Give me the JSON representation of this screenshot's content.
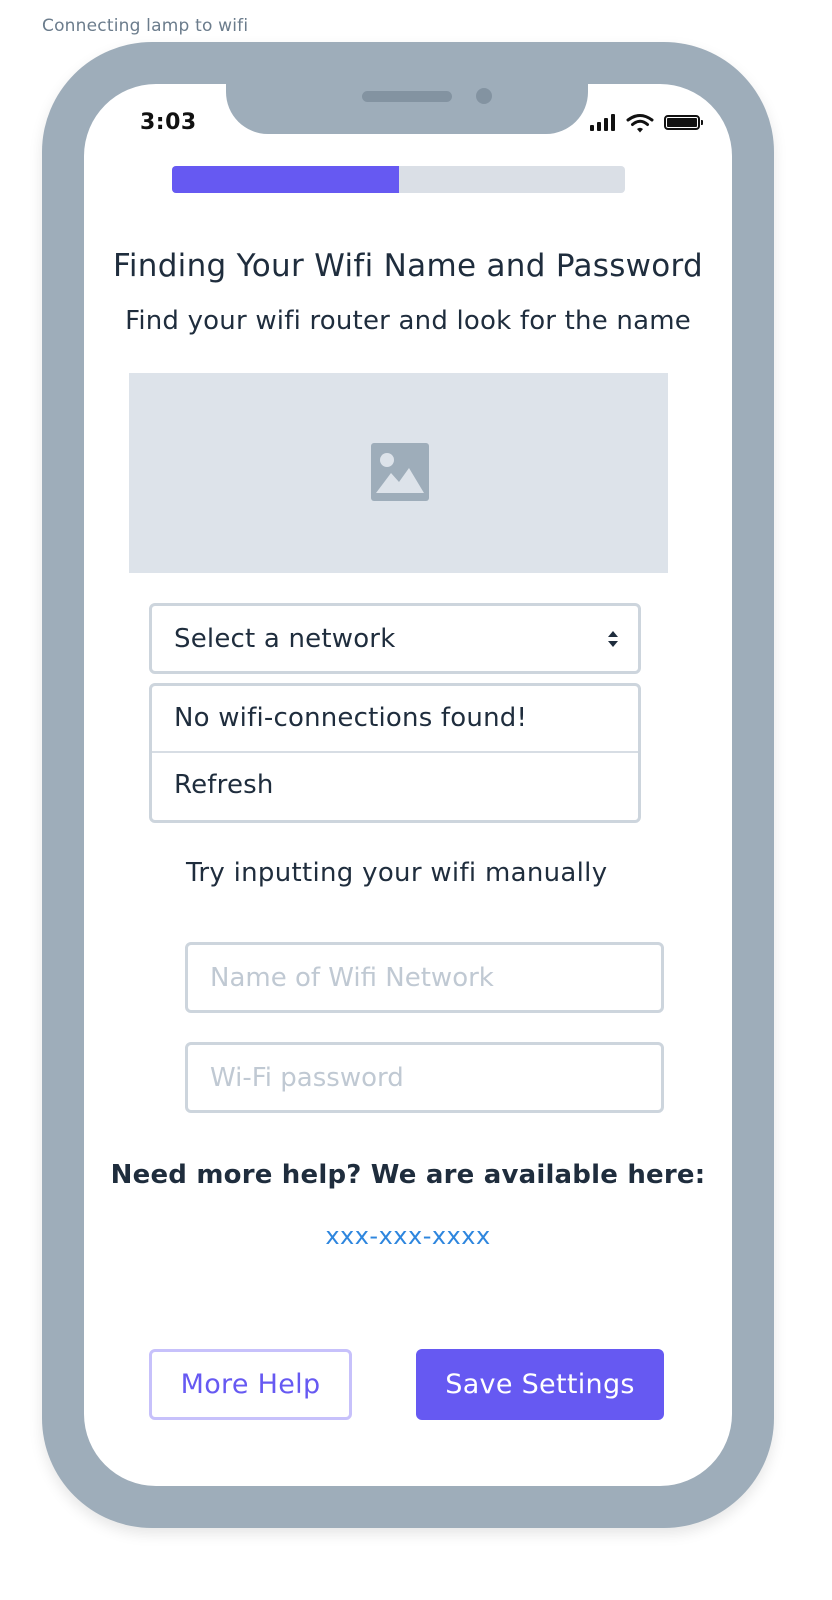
{
  "frame": {
    "label": "Connecting lamp to wifi"
  },
  "status_bar": {
    "time": "3:03"
  },
  "progress": {
    "fraction": 0.5,
    "fill_color": "#6659f2",
    "track_color": "#dadfe6"
  },
  "header": {
    "title": "Finding Your Wifi Name and Password",
    "subtitle": "Find your wifi router and look for the name"
  },
  "image": {
    "icon": "image-placeholder-icon"
  },
  "network_select": {
    "label": "Select a network",
    "icon": "chevron-updown-icon",
    "options": [
      "No wifi-connections found!",
      "Refresh"
    ]
  },
  "manual": {
    "hint": "Try inputting your wifi manually",
    "name_placeholder": "Name of Wifi Network",
    "password_placeholder": "Wi-Fi password"
  },
  "help": {
    "heading": "Need more help? We are available here:",
    "phone": "xxx-xxx-xxxx"
  },
  "buttons": {
    "more_help": "More Help",
    "save_settings": "Save Settings"
  },
  "colors": {
    "accent": "#6659f2",
    "link": "#2e86de",
    "phone_frame": "#9eadba"
  }
}
